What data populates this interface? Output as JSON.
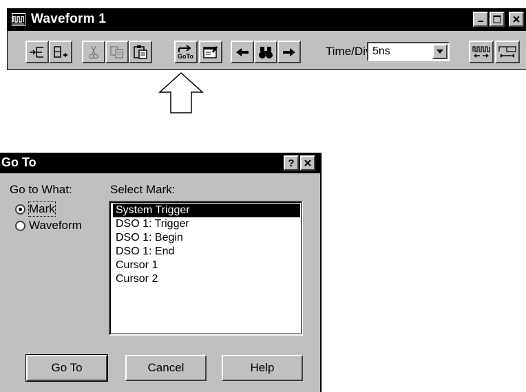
{
  "waveform_window": {
    "title": "Waveform 1",
    "title_icon": "waveform-icon",
    "window_buttons": [
      "minimize-icon",
      "maximize-icon",
      "close-icon"
    ],
    "toolbar": {
      "buttons": [
        "insert-signal-icon",
        "insert-bus-icon",
        "cut-icon",
        "copy-icon",
        "paste-icon",
        "goto-icon",
        "properties-icon",
        "arrow-left-icon",
        "find-binoculars-icon",
        "arrow-right-icon",
        "zoom-in-icon",
        "zoom-out-icon"
      ],
      "goto_icon_text": "GoTo",
      "time_div_label": "Time/Div:",
      "time_div_value": "5ns"
    }
  },
  "callout": {
    "icon": "up-arrow-outline-icon"
  },
  "goto_dialog": {
    "title": "Go To",
    "title_buttons": [
      "help-question-icon",
      "close-icon"
    ],
    "go_to_what_label": "Go to What:",
    "radios": [
      {
        "label": "Mark",
        "selected": true
      },
      {
        "label": "Waveform",
        "selected": false
      }
    ],
    "select_mark_label": "Select Mark:",
    "marks": [
      "System Trigger",
      "DSO 1: Trigger",
      "DSO 1: Begin",
      "DSO 1: End",
      "Cursor 1",
      "Cursor 2"
    ],
    "selected_mark": "System Trigger",
    "buttons": {
      "goto": "Go To",
      "cancel": "Cancel",
      "help": "Help"
    }
  }
}
